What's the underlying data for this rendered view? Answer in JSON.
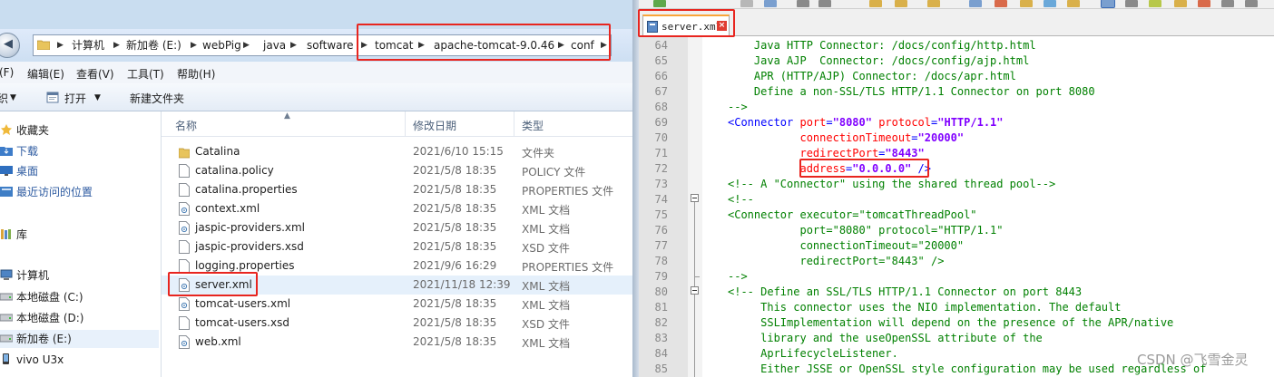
{
  "explorer": {
    "breadcrumb": [
      "计算机",
      "新加卷 (E:)",
      "webPig",
      "java",
      "software",
      "tomcat",
      "apache-tomcat-9.0.46",
      "conf"
    ],
    "menu": [
      "(F)",
      "编辑(E)",
      "查看(V)",
      "工具(T)",
      "帮助(H)"
    ],
    "toolbar": {
      "organize_fragment": "织",
      "open": "打开",
      "new_folder": "新建文件夹"
    },
    "nav": [
      {
        "label": "收藏夹",
        "icon": "star-icon"
      },
      {
        "label": "下载",
        "icon": "download-folder-icon"
      },
      {
        "label": "桌面",
        "icon": "desktop-icon"
      },
      {
        "label": "最近访问的位置",
        "icon": "recent-places-icon"
      },
      {
        "label": "库",
        "icon": "library-icon"
      },
      {
        "label": "计算机",
        "icon": "computer-icon"
      },
      {
        "label": "本地磁盘 (C:)",
        "icon": "drive-icon"
      },
      {
        "label": "本地磁盘 (D:)",
        "icon": "drive-icon"
      },
      {
        "label": "新加卷 (E:)",
        "icon": "drive-icon"
      },
      {
        "label": "vivo U3x",
        "icon": "phone-icon"
      }
    ],
    "columns": {
      "name": "名称",
      "date": "修改日期",
      "type": "类型"
    },
    "files": [
      {
        "name": "Catalina",
        "date": "2021/6/10 15:15",
        "type": "文件夹",
        "icon": "folder-icon"
      },
      {
        "name": "catalina.policy",
        "date": "2021/5/8 18:35",
        "type": "POLICY 文件",
        "icon": "file-icon"
      },
      {
        "name": "catalina.properties",
        "date": "2021/5/8 18:35",
        "type": "PROPERTIES 文件",
        "icon": "file-icon"
      },
      {
        "name": "context.xml",
        "date": "2021/5/8 18:35",
        "type": "XML 文档",
        "icon": "xml-file-icon"
      },
      {
        "name": "jaspic-providers.xml",
        "date": "2021/5/8 18:35",
        "type": "XML 文档",
        "icon": "xml-file-icon"
      },
      {
        "name": "jaspic-providers.xsd",
        "date": "2021/5/8 18:35",
        "type": "XSD 文件",
        "icon": "file-icon"
      },
      {
        "name": "logging.properties",
        "date": "2021/9/6 16:29",
        "type": "PROPERTIES 文件",
        "icon": "file-icon"
      },
      {
        "name": "server.xml",
        "date": "2021/11/18 12:39",
        "type": "XML 文档",
        "icon": "xml-file-icon"
      },
      {
        "name": "tomcat-users.xml",
        "date": "2021/5/8 18:35",
        "type": "XML 文档",
        "icon": "xml-file-icon"
      },
      {
        "name": "tomcat-users.xsd",
        "date": "2021/5/8 18:35",
        "type": "XSD 文件",
        "icon": "file-icon"
      },
      {
        "name": "web.xml",
        "date": "2021/5/8 18:35",
        "type": "XML 文档",
        "icon": "xml-file-icon"
      }
    ],
    "selected_file": "server.xml"
  },
  "editor": {
    "tab_label": "server.xml",
    "lines": [
      {
        "n": "64",
        "parts": [
          {
            "t": "    Java HTTP Connector: /docs/config/http.html",
            "c": "cm"
          }
        ]
      },
      {
        "n": "65",
        "parts": [
          {
            "t": "    Java AJP  Connector: /docs/config/ajp.html",
            "c": "cm"
          }
        ]
      },
      {
        "n": "66",
        "parts": [
          {
            "t": "    APR (HTTP/AJP) Connector: /docs/apr.html",
            "c": "cm"
          }
        ]
      },
      {
        "n": "67",
        "parts": [
          {
            "t": "    Define a non-SSL/TLS HTTP/1.1 Connector on port 8080",
            "c": "cm"
          }
        ]
      },
      {
        "n": "68",
        "parts": [
          {
            "t": "-->",
            "c": "cm"
          }
        ]
      },
      {
        "n": "69",
        "parts": [
          {
            "t": "<Connector ",
            "c": "tag"
          },
          {
            "t": "port",
            "c": "attr"
          },
          {
            "t": "=",
            "c": "tag"
          },
          {
            "t": "\"8080\"",
            "c": "val"
          },
          {
            "t": " protocol",
            "c": "attr"
          },
          {
            "t": "=",
            "c": "tag"
          },
          {
            "t": "\"HTTP/1.1\"",
            "c": "val"
          }
        ]
      },
      {
        "n": "70",
        "parts": [
          {
            "t": "           connectionTimeout",
            "c": "attr"
          },
          {
            "t": "=",
            "c": "tag"
          },
          {
            "t": "\"20000\"",
            "c": "val"
          }
        ]
      },
      {
        "n": "71",
        "parts": [
          {
            "t": "           redirectPort",
            "c": "attr"
          },
          {
            "t": "=",
            "c": "tag"
          },
          {
            "t": "\"8443\"",
            "c": "val"
          }
        ]
      },
      {
        "n": "72",
        "parts": [
          {
            "t": "           address",
            "c": "attr"
          },
          {
            "t": "=",
            "c": "tag"
          },
          {
            "t": "\"0.0.0.0\"",
            "c": "val"
          },
          {
            "t": " />",
            "c": "tag"
          }
        ]
      },
      {
        "n": "73",
        "parts": [
          {
            "t": "<!-- A \"Connector\" using the shared thread pool-->",
            "c": "cm"
          }
        ]
      },
      {
        "n": "74",
        "parts": [
          {
            "t": "<!--",
            "c": "cm"
          }
        ]
      },
      {
        "n": "75",
        "parts": [
          {
            "t": "<Connector executor=\"tomcatThreadPool\"",
            "c": "cm"
          }
        ]
      },
      {
        "n": "76",
        "parts": [
          {
            "t": "           port=\"8080\" protocol=\"HTTP/1.1\"",
            "c": "cm"
          }
        ]
      },
      {
        "n": "77",
        "parts": [
          {
            "t": "           connectionTimeout=\"20000\"",
            "c": "cm"
          }
        ]
      },
      {
        "n": "78",
        "parts": [
          {
            "t": "           redirectPort=\"8443\" />",
            "c": "cm"
          }
        ]
      },
      {
        "n": "79",
        "parts": [
          {
            "t": "-->",
            "c": "cm"
          }
        ]
      },
      {
        "n": "80",
        "parts": [
          {
            "t": "<!-- Define an SSL/TLS HTTP/1.1 Connector on port 8443",
            "c": "cm"
          }
        ]
      },
      {
        "n": "81",
        "parts": [
          {
            "t": "     This connector uses the NIO implementation. The default",
            "c": "cm"
          }
        ]
      },
      {
        "n": "82",
        "parts": [
          {
            "t": "     SSLImplementation will depend on the presence of the APR/native",
            "c": "cm"
          }
        ]
      },
      {
        "n": "83",
        "parts": [
          {
            "t": "     library and the useOpenSSL attribute of the",
            "c": "cm"
          }
        ]
      },
      {
        "n": "84",
        "parts": [
          {
            "t": "     AprLifecycleListener.",
            "c": "cm"
          }
        ]
      },
      {
        "n": "85",
        "parts": [
          {
            "t": "     Either JSSE or OpenSSL style configuration may be used regardless of",
            "c": "cm"
          }
        ]
      }
    ]
  },
  "watermark": "CSDN @飞雪金灵",
  "colors": {
    "highlight_box": "#e8251f",
    "xml_comment": "#008000",
    "xml_tag": "#0000ff",
    "xml_attribute": "#ff0000",
    "xml_value": "#8000ff"
  }
}
